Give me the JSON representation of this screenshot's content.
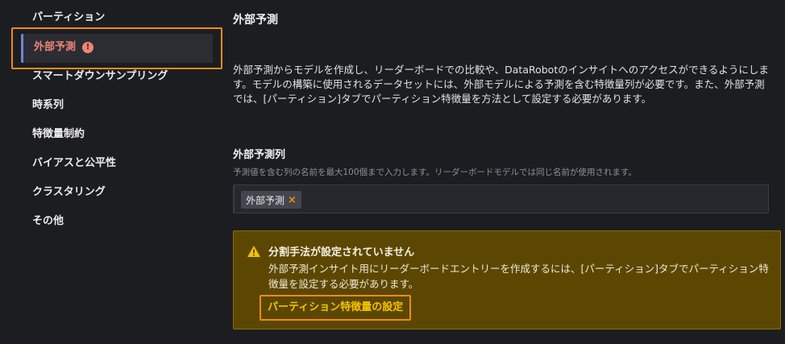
{
  "sidebar": {
    "items": [
      {
        "label": "パーティション"
      },
      {
        "label": "外部予測",
        "active": true,
        "status": "error"
      },
      {
        "label": "スマートダウンサンプリング"
      },
      {
        "label": "時系列"
      },
      {
        "label": "特徴量制約"
      },
      {
        "label": "バイアスと公平性"
      },
      {
        "label": "クラスタリング"
      },
      {
        "label": "その他"
      }
    ]
  },
  "main": {
    "title": "外部予測",
    "description": "外部予測からモデルを作成し、リーダーボードでの比較や、DataRobotのインサイトへのアクセスができるようにします。モデルの構築に使用されるデータセットには、外部モデルによる予測を含む特徴量列が必要です。また、外部予測では、[パーティション]タブでパーティション特徴量を方法として設定する必要があります。",
    "field": {
      "label": "外部予測列",
      "help": "予測値を含む列の名前を最大100個まで入力します。リーダーボードモデルでは同じ名前が使用されます。",
      "tags": [
        {
          "label": "外部予測",
          "remove_icon": "×"
        }
      ]
    },
    "warning": {
      "icon": "warning-triangle-icon",
      "title": "分割手法が設定されていません",
      "text": "外部予測インサイト用にリーダーボードエントリーを作成するには、[パーティション]タブでパーティション特徴量を設定する必要があります。",
      "link": "パーティション特徴量の設定"
    }
  },
  "colors": {
    "background": "#1c1d21",
    "accent_orange": "#ef8a1a",
    "error": "#ee8577",
    "warning_bg": "#5c4702",
    "link": "#f5c300"
  }
}
